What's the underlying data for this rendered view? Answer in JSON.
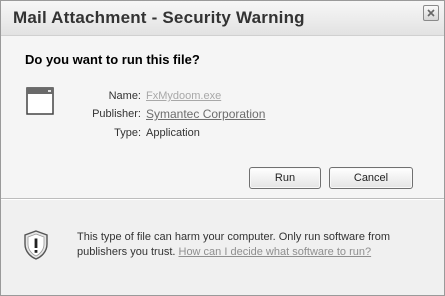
{
  "window": {
    "title": "Mail Attachment - Security Warning"
  },
  "dialog": {
    "question": "Do you want to run this file?",
    "fields": {
      "name_label": "Name:",
      "name_value": "FxMydoom.exe",
      "publisher_label": "Publisher:",
      "publisher_value": "Symantec Corporation",
      "type_label": "Type:",
      "type_value": "Application"
    },
    "buttons": {
      "run": "Run",
      "cancel": "Cancel"
    },
    "warning": {
      "text": "This type of file can harm your computer. Only run software from publishers you trust.",
      "link": "How can I decide what software to run?"
    }
  },
  "icons": {
    "close": "close-icon",
    "application": "application-window-icon",
    "warning": "shield-warning-icon"
  }
}
